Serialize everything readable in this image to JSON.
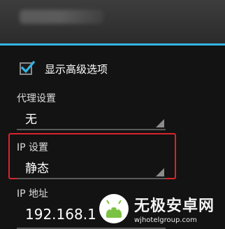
{
  "checkbox": {
    "label": "显示高级选项",
    "checked": true
  },
  "proxy": {
    "label": "代理设置",
    "value": "无"
  },
  "ip_settings": {
    "label": "IP 设置",
    "value": "静态"
  },
  "ip_address": {
    "label": "IP 地址",
    "value": "192.168.1"
  },
  "watermark": {
    "title": "无极安卓网",
    "url": "wjhotelgroup.com"
  },
  "colors": {
    "accent": "#33b5e5",
    "highlight": "#d8242c",
    "background": "#131313"
  }
}
